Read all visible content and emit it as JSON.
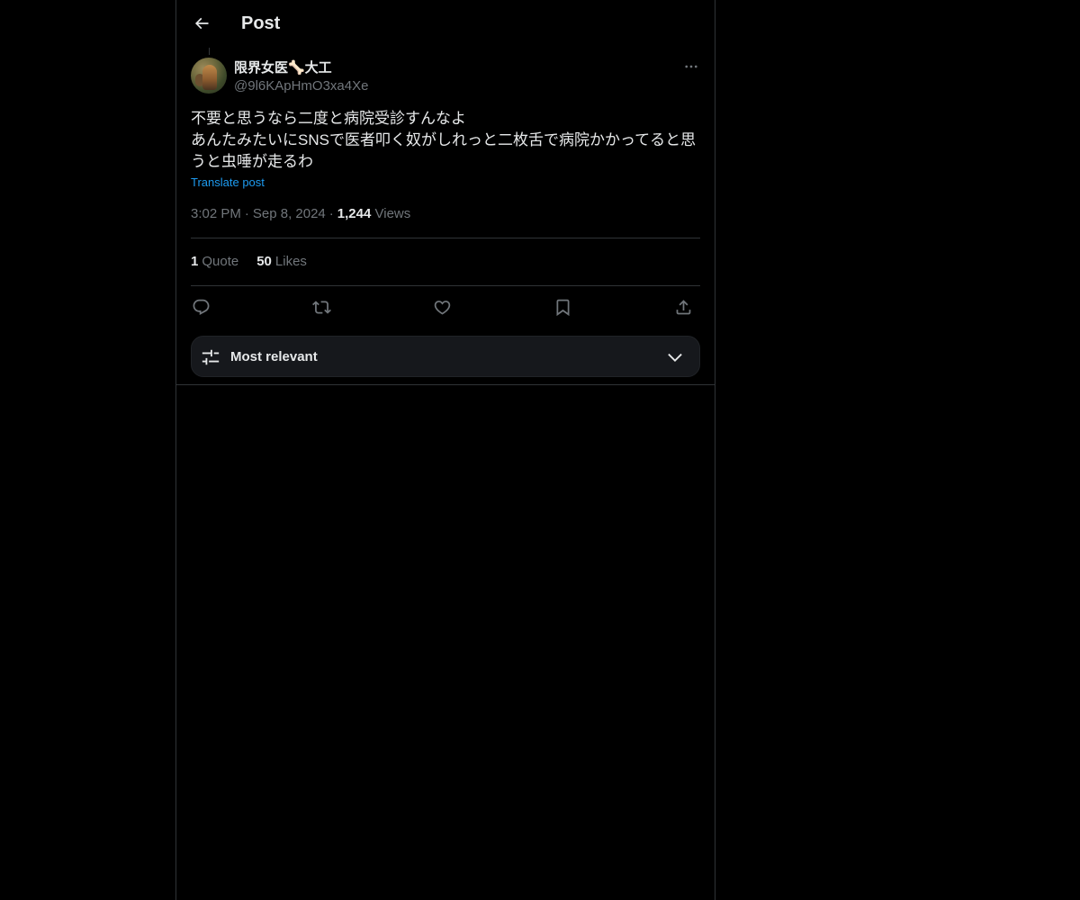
{
  "header": {
    "title": "Post",
    "back_icon": "arrow-left-icon"
  },
  "post": {
    "author": {
      "display_name": "限界女医🦴大工",
      "handle": "@9l6KApHmO3xa4Xe"
    },
    "text": "不要と思うなら二度と病院受診すんなよ\nあんたみたいにSNSで医者叩く奴がしれっと二枚舌で病院かかってると思うと虫唾が走るわ",
    "translate_label": "Translate post",
    "time": "3:02 PM",
    "date": "Sep 8, 2024",
    "separator": "·",
    "views_count": "1,244",
    "views_label": "Views",
    "stats": {
      "quotes_count": "1",
      "quotes_label": "Quote",
      "likes_count": "50",
      "likes_label": "Likes"
    },
    "actions": [
      "reply-icon",
      "repost-icon",
      "like-icon",
      "bookmark-icon",
      "share-icon"
    ]
  },
  "sort": {
    "label": "Most relevant",
    "icon": "sliders-icon",
    "chevron": "chevron-down-icon"
  },
  "colors": {
    "background": "#000000",
    "text_primary": "#e7e9ea",
    "text_secondary": "#71767b",
    "link": "#1d9bf0",
    "border": "#2f3336"
  }
}
